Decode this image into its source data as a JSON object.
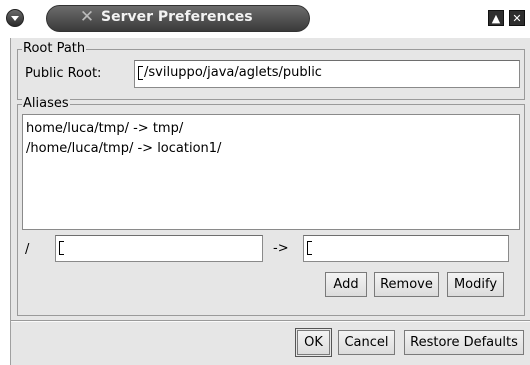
{
  "window": {
    "title": "Server Preferences"
  },
  "root_path": {
    "legend": "Root Path",
    "public_root_label": "Public Root:",
    "public_root_value": "/sviluppo/java/aglets/public"
  },
  "aliases": {
    "legend": "Aliases",
    "items": [
      "home/luca/tmp/ -> tmp/",
      "/home/luca/tmp/ -> location1/"
    ],
    "prefix_label": "/",
    "arrow_label": "->",
    "from_value": "",
    "to_value": "",
    "add_label": "Add",
    "remove_label": "Remove",
    "modify_label": "Modify"
  },
  "footer": {
    "ok_label": "OK",
    "cancel_label": "Cancel",
    "restore_label": "Restore Defaults"
  }
}
